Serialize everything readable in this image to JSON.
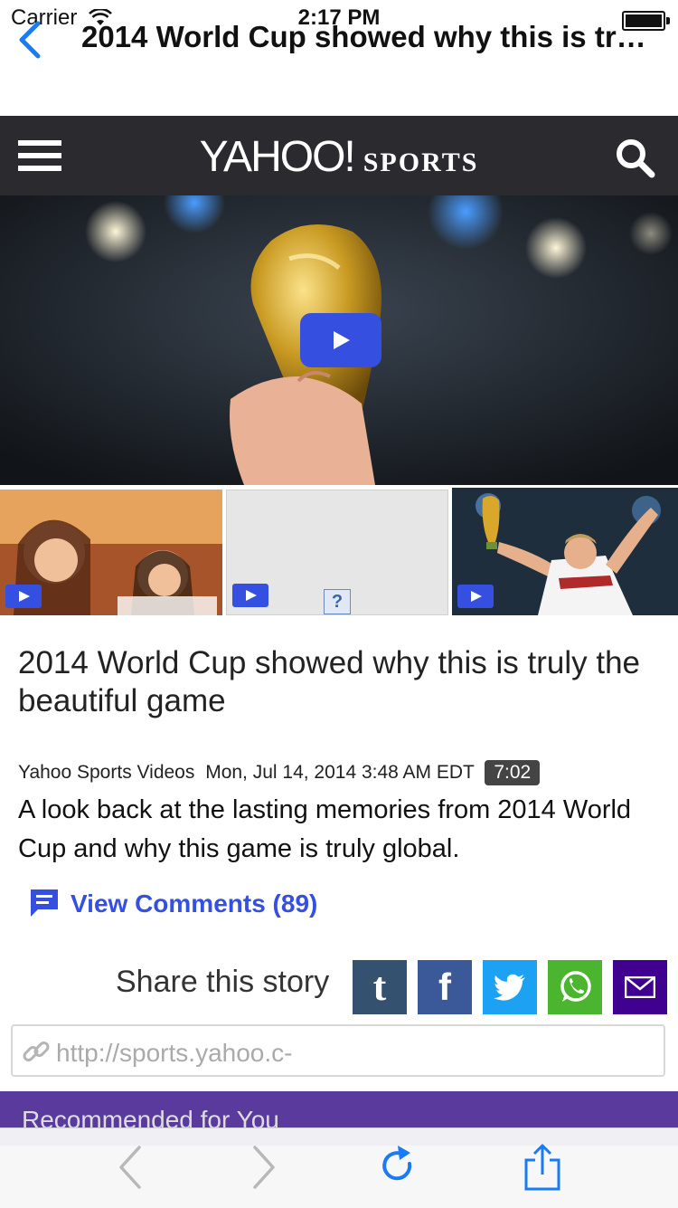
{
  "status_bar": {
    "carrier": "Carrier",
    "time": "2:17 PM"
  },
  "nav": {
    "title": "2014 World Cup showed why this is tr…"
  },
  "header": {
    "logo_yahoo": "YAHOO!",
    "logo_sports": "SPORTS"
  },
  "video": {
    "help_glyph": "?"
  },
  "article": {
    "headline": "2014 World Cup showed why this is truly the beautiful game",
    "source": "Yahoo Sports Videos",
    "date": "Mon, Jul 14, 2014 3:48 AM EDT",
    "duration": "7:02",
    "summary": "A look back at the lasting memories from 2014 World Cup and why this game is truly global."
  },
  "comments": {
    "label": "View Comments (89)"
  },
  "share": {
    "label": "Share this story",
    "url": "http://sports.yahoo.c-",
    "buttons": [
      {
        "name": "tumblr",
        "glyph": "t",
        "color": "#34526f"
      },
      {
        "name": "facebook",
        "glyph": "f",
        "color": "#3b5998"
      },
      {
        "name": "twitter",
        "glyph": "twitter-bird",
        "color": "#1da1f2"
      },
      {
        "name": "whatsapp",
        "glyph": "whatsapp",
        "color": "#4cb52f"
      },
      {
        "name": "email",
        "glyph": "envelope",
        "color": "#400090"
      }
    ]
  },
  "recommended": {
    "label": "Recommended for You"
  },
  "colors": {
    "accent": "#3550e0",
    "header_bg": "#2a2a2f",
    "rec_bg": "#5b3a9e",
    "ios_blue": "#1a7cf5"
  }
}
